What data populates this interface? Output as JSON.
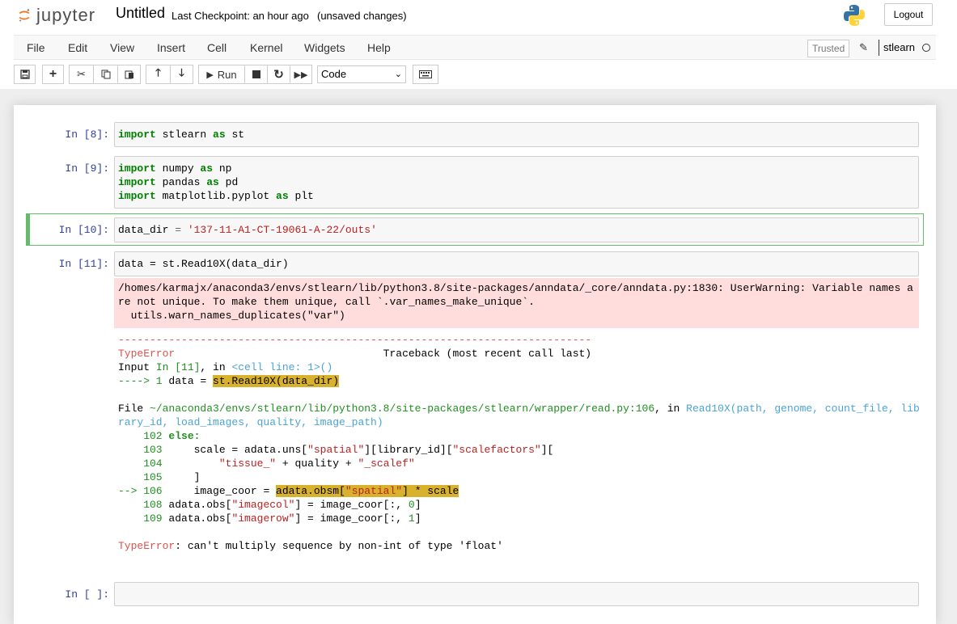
{
  "header": {
    "logo_text": "jupyter",
    "notebook_title": "Untitled",
    "checkpoint": "Last Checkpoint: an hour ago",
    "unsaved": "(unsaved changes)",
    "logout_label": "Logout"
  },
  "menu": [
    "File",
    "Edit",
    "View",
    "Insert",
    "Cell",
    "Kernel",
    "Widgets",
    "Help"
  ],
  "status": {
    "trusted": "Trusted",
    "kernel": "stlearn"
  },
  "toolbar": {
    "run_label": "Run",
    "cell_type": "Code"
  },
  "cells": {
    "c1": {
      "prompt": "In [8]:",
      "line1": [
        "import",
        " stlearn ",
        "as",
        " st"
      ]
    },
    "c2": {
      "prompt": "In [9]:",
      "lines": [
        [
          "import",
          " numpy ",
          "as",
          " np"
        ],
        [
          "import",
          " pandas ",
          "as",
          " pd"
        ],
        [
          "import",
          " matplotlib.pyplot ",
          "as",
          " plt"
        ]
      ]
    },
    "c3": {
      "prompt": "In [10]:",
      "var": "data_dir ",
      "op": "=",
      "str": " '137-11-A1-CT-19061-A-22/outs'"
    },
    "c4": {
      "prompt": "In [11]:",
      "code": "data = st.Read10X(data_dir)"
    },
    "c5": {
      "prompt": "In [ ]:"
    }
  },
  "warning": "/homes/karmajx/anaconda3/envs/stlearn/lib/python3.8/site-packages/anndata/_core/anndata.py:1830: UserWarning: Variable names are not unique. To make them unique, call `.var_names_make_unique`.\n  utils.warn_names_duplicates(\"var\")",
  "traceback": {
    "dashes": "---------------------------------------------------------------------------",
    "error_type": "TypeError",
    "tb_header": "                                 Traceback (most recent call last)",
    "input_prefix": "Input ",
    "input_in": "In [11]",
    "input_mid": ", in ",
    "input_cell": "<cell line: 1>()",
    "arrow1": "----> 1",
    "line1_a": " data = ",
    "line1_hl": "st.Read10X(data_dir)",
    "file_prefix": "File ",
    "file_path": "~/anaconda3/envs/stlearn/lib/python3.8/site-packages/stlearn/wrapper/read.py:106",
    "file_mid": ", in ",
    "file_func1": "Read10X(path, genome, count_file, lib",
    "file_func2": "rary_id, load_images, quality, image_path)",
    "l102n": "    102 ",
    "l102": "else:",
    "l103n": "    103 ",
    "l103a": "    scale = adata.uns[",
    "l103s1": "\"spatial\"",
    "l103b": "][library_id][",
    "l103s2": "\"scalefactors\"",
    "l103c": "][",
    "l104n": "    104 ",
    "l104a": "        ",
    "l104s1": "\"tissue_\"",
    "l104b": " + quality + ",
    "l104s2": "\"_scalef\"",
    "l105n": "    105 ",
    "l105": "    ]",
    "arrow106": "--> 106 ",
    "l106a": "    image_coor = ",
    "l106hl1": "adata.obsm[",
    "l106hls": "\"spatial\"",
    "l106hl2": "] * scale",
    "l108n": "    108 ",
    "l108a": "adata.obs[",
    "l108s": "\"imagecol\"",
    "l108b": "] = image_coor[:, ",
    "l108num": "0",
    "l108c": "]",
    "l109n": "    109 ",
    "l109a": "adata.obs[",
    "l109s": "\"imagerow\"",
    "l109b": "] = image_coor[:, ",
    "l109num": "1",
    "l109c": "]",
    "final_type": "TypeError",
    "final_msg": ": can't multiply sequence by non-int of type 'float'"
  }
}
